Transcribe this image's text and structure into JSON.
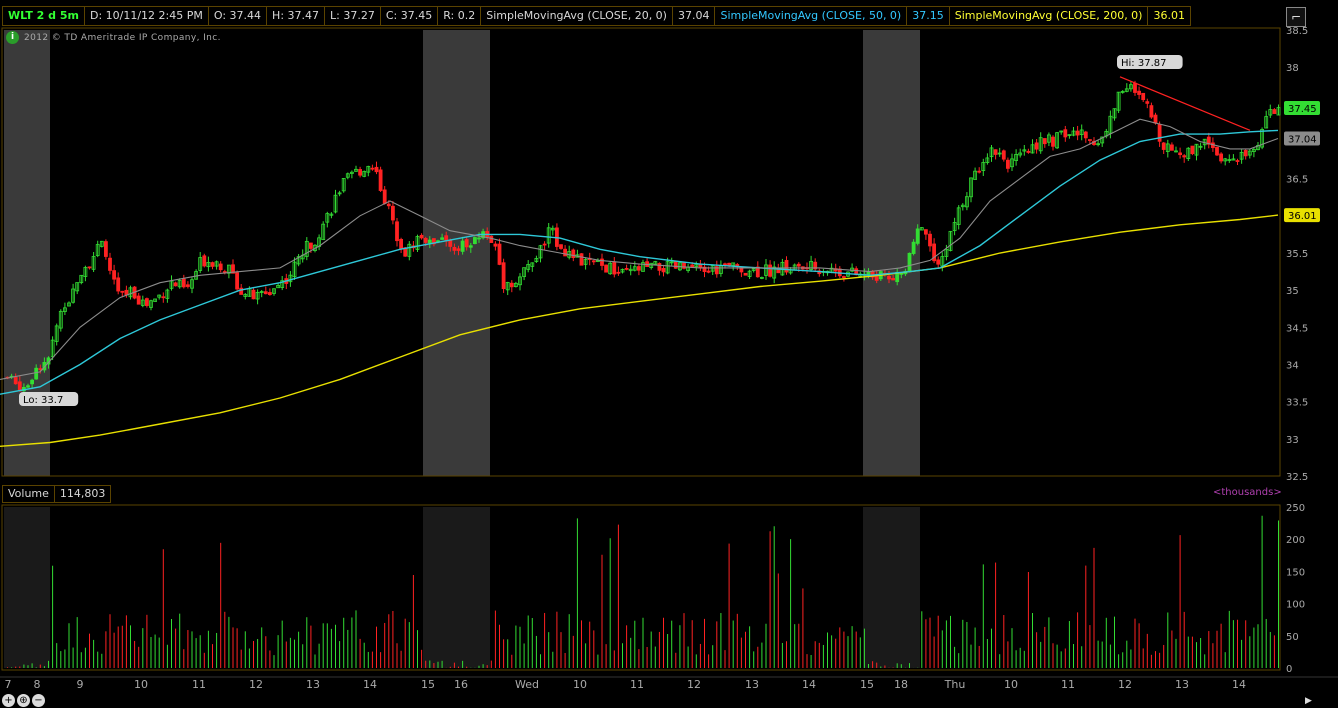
{
  "header": {
    "symbol": "WLT 2 d 5m",
    "date": "D: 10/11/12 2:45 PM",
    "open": "O: 37.44",
    "high": "H: 37.47",
    "low": "L: 37.27",
    "close": "C: 37.45",
    "range": "R: 0.2",
    "sma20_label": "SimpleMovingAvg (CLOSE, 20, 0)",
    "sma20_value": "37.04",
    "sma50_label": "SimpleMovingAvg (CLOSE, 50, 0)",
    "sma50_value": "37.15",
    "sma200_label": "SimpleMovingAvg (CLOSE, 200, 0)",
    "sma200_value": "36.01"
  },
  "copyright": "2012 © TD Ameritrade IP Company, Inc.",
  "volume_header": {
    "label": "Volume",
    "value": "114,803",
    "units": "<thousands>"
  },
  "icons": [
    "green-info-icon",
    "zoom-fit-icon",
    "zoom-in-icon",
    "zoom-out-icon",
    "scroll-right-icon"
  ],
  "colors": {
    "up": "#33dd33",
    "down": "#ff2222",
    "sma20": "#8c8c8c",
    "sma50": "#2ec8d8",
    "sma200": "#e8e000",
    "session_shade": "#3a3a3a",
    "trend": "#ff2222"
  },
  "chart_data": [
    {
      "type": "candlestick",
      "symbol": "WLT",
      "interval": "5m",
      "ylim": [
        32.5,
        38.5
      ],
      "yticks": [
        32.5,
        33,
        33.5,
        34,
        34.5,
        35,
        35.5,
        36,
        36.5,
        37,
        37.5,
        38,
        38.5
      ],
      "xticks": [
        "7",
        "8",
        "9",
        "10",
        "11",
        "12",
        "13",
        "14",
        "15",
        "16",
        "Wed",
        "10",
        "11",
        "12",
        "13",
        "14",
        "15",
        "18",
        "Thu",
        "10",
        "11",
        "12",
        "13",
        "14"
      ],
      "annotations": {
        "high": "Hi: 37.87",
        "low": "Lo: 33.7"
      },
      "price_flags": [
        {
          "label": "37.45",
          "value": 37.45,
          "color": "#33dd33"
        },
        {
          "label": "37.04",
          "value": 37.04,
          "color": "#8c8c8c"
        },
        {
          "label": "36.01",
          "value": 36.01,
          "color": "#e8e000"
        }
      ],
      "close_path": [
        [
          0,
          33.9
        ],
        [
          12,
          33.75
        ],
        [
          24,
          33.7
        ],
        [
          36,
          34.0
        ],
        [
          48,
          34.05
        ],
        [
          56,
          34.6
        ],
        [
          66,
          34.7
        ],
        [
          76,
          35.2
        ],
        [
          88,
          35.4
        ],
        [
          100,
          35.6
        ],
        [
          108,
          35.3
        ],
        [
          118,
          34.9
        ],
        [
          130,
          35.0
        ],
        [
          144,
          34.8
        ],
        [
          156,
          34.9
        ],
        [
          170,
          35.1
        ],
        [
          186,
          35.0
        ],
        [
          200,
          35.4
        ],
        [
          212,
          35.4
        ],
        [
          226,
          35.3
        ],
        [
          240,
          35.0
        ],
        [
          254,
          34.9
        ],
        [
          270,
          35.0
        ],
        [
          288,
          35.2
        ],
        [
          300,
          35.5
        ],
        [
          314,
          35.7
        ],
        [
          326,
          36.0
        ],
        [
          340,
          36.4
        ],
        [
          356,
          36.6
        ],
        [
          372,
          36.7
        ],
        [
          384,
          36.2
        ],
        [
          394,
          35.8
        ],
        [
          404,
          35.5
        ],
        [
          416,
          35.7
        ],
        [
          432,
          35.7
        ],
        [
          452,
          35.6
        ],
        [
          470,
          35.6
        ],
        [
          484,
          35.8
        ],
        [
          494,
          35.6
        ],
        [
          502,
          35.1
        ],
        [
          514,
          35.1
        ],
        [
          526,
          35.3
        ],
        [
          538,
          35.5
        ],
        [
          548,
          35.8
        ],
        [
          560,
          35.6
        ],
        [
          574,
          35.4
        ],
        [
          590,
          35.35
        ],
        [
          606,
          35.3
        ],
        [
          622,
          35.2
        ],
        [
          640,
          35.3
        ],
        [
          660,
          35.3
        ],
        [
          680,
          35.3
        ],
        [
          700,
          35.25
        ],
        [
          720,
          35.3
        ],
        [
          740,
          35.3
        ],
        [
          760,
          35.25
        ],
        [
          780,
          35.3
        ],
        [
          800,
          35.3
        ],
        [
          820,
          35.3
        ],
        [
          840,
          35.25
        ],
        [
          860,
          35.2
        ],
        [
          876,
          35.2
        ],
        [
          890,
          35.2
        ],
        [
          904,
          35.2
        ],
        [
          914,
          35.8
        ],
        [
          924,
          35.8
        ],
        [
          934,
          35.4
        ],
        [
          944,
          35.5
        ],
        [
          952,
          35.9
        ],
        [
          962,
          36.2
        ],
        [
          972,
          36.5
        ],
        [
          982,
          36.8
        ],
        [
          994,
          36.9
        ],
        [
          1008,
          36.7
        ],
        [
          1022,
          36.8
        ],
        [
          1036,
          37.0
        ],
        [
          1050,
          37.0
        ],
        [
          1064,
          37.1
        ],
        [
          1078,
          37.1
        ],
        [
          1092,
          37.0
        ],
        [
          1104,
          37.1
        ],
        [
          1116,
          37.6
        ],
        [
          1124,
          37.8
        ],
        [
          1136,
          37.6
        ],
        [
          1148,
          37.4
        ],
        [
          1160,
          37.0
        ],
        [
          1172,
          36.9
        ],
        [
          1184,
          36.8
        ],
        [
          1196,
          37.0
        ],
        [
          1208,
          37.0
        ],
        [
          1220,
          36.8
        ],
        [
          1232,
          36.7
        ],
        [
          1244,
          36.8
        ],
        [
          1256,
          37.0
        ],
        [
          1266,
          37.4
        ],
        [
          1276,
          37.45
        ]
      ],
      "sma20_path": [
        [
          0,
          33.8
        ],
        [
          40,
          33.9
        ],
        [
          80,
          34.5
        ],
        [
          120,
          34.9
        ],
        [
          160,
          35.1
        ],
        [
          200,
          35.2
        ],
        [
          240,
          35.25
        ],
        [
          280,
          35.3
        ],
        [
          320,
          35.6
        ],
        [
          360,
          36.0
        ],
        [
          390,
          36.2
        ],
        [
          420,
          36.0
        ],
        [
          450,
          35.8
        ],
        [
          490,
          35.7
        ],
        [
          520,
          35.6
        ],
        [
          560,
          35.5
        ],
        [
          600,
          35.4
        ],
        [
          640,
          35.35
        ],
        [
          700,
          35.3
        ],
        [
          760,
          35.3
        ],
        [
          820,
          35.3
        ],
        [
          870,
          35.25
        ],
        [
          900,
          35.3
        ],
        [
          930,
          35.4
        ],
        [
          960,
          35.7
        ],
        [
          990,
          36.2
        ],
        [
          1020,
          36.5
        ],
        [
          1050,
          36.8
        ],
        [
          1080,
          36.9
        ],
        [
          1110,
          37.1
        ],
        [
          1140,
          37.3
        ],
        [
          1170,
          37.2
        ],
        [
          1200,
          37.0
        ],
        [
          1230,
          36.9
        ],
        [
          1250,
          36.9
        ],
        [
          1278,
          37.04
        ]
      ],
      "sma50_path": [
        [
          0,
          33.6
        ],
        [
          40,
          33.7
        ],
        [
          80,
          34.0
        ],
        [
          120,
          34.35
        ],
        [
          160,
          34.6
        ],
        [
          200,
          34.8
        ],
        [
          240,
          35.0
        ],
        [
          280,
          35.1
        ],
        [
          320,
          35.25
        ],
        [
          360,
          35.4
        ],
        [
          400,
          35.55
        ],
        [
          440,
          35.65
        ],
        [
          480,
          35.75
        ],
        [
          520,
          35.75
        ],
        [
          560,
          35.7
        ],
        [
          600,
          35.55
        ],
        [
          640,
          35.45
        ],
        [
          700,
          35.35
        ],
        [
          760,
          35.3
        ],
        [
          820,
          35.25
        ],
        [
          870,
          35.2
        ],
        [
          910,
          35.25
        ],
        [
          940,
          35.3
        ],
        [
          980,
          35.6
        ],
        [
          1020,
          36.0
        ],
        [
          1060,
          36.4
        ],
        [
          1100,
          36.75
        ],
        [
          1140,
          37.0
        ],
        [
          1180,
          37.1
        ],
        [
          1220,
          37.1
        ],
        [
          1250,
          37.13
        ],
        [
          1278,
          37.15
        ]
      ],
      "sma200_path": [
        [
          0,
          32.9
        ],
        [
          50,
          32.95
        ],
        [
          100,
          33.05
        ],
        [
          160,
          33.2
        ],
        [
          220,
          33.35
        ],
        [
          280,
          33.55
        ],
        [
          340,
          33.8
        ],
        [
          400,
          34.1
        ],
        [
          460,
          34.4
        ],
        [
          520,
          34.6
        ],
        [
          580,
          34.75
        ],
        [
          640,
          34.85
        ],
        [
          700,
          34.95
        ],
        [
          760,
          35.05
        ],
        [
          820,
          35.12
        ],
        [
          880,
          35.2
        ],
        [
          940,
          35.3
        ],
        [
          1000,
          35.5
        ],
        [
          1060,
          35.65
        ],
        [
          1120,
          35.78
        ],
        [
          1180,
          35.88
        ],
        [
          1240,
          35.95
        ],
        [
          1278,
          36.01
        ]
      ],
      "session_shades": [
        [
          4,
          50
        ],
        [
          423,
          490
        ],
        [
          863,
          920
        ]
      ]
    },
    {
      "type": "bar",
      "name": "Volume",
      "ylim": [
        0,
        250
      ],
      "yticks": [
        0,
        50,
        100,
        150,
        200,
        250
      ],
      "units": "thousands"
    }
  ]
}
